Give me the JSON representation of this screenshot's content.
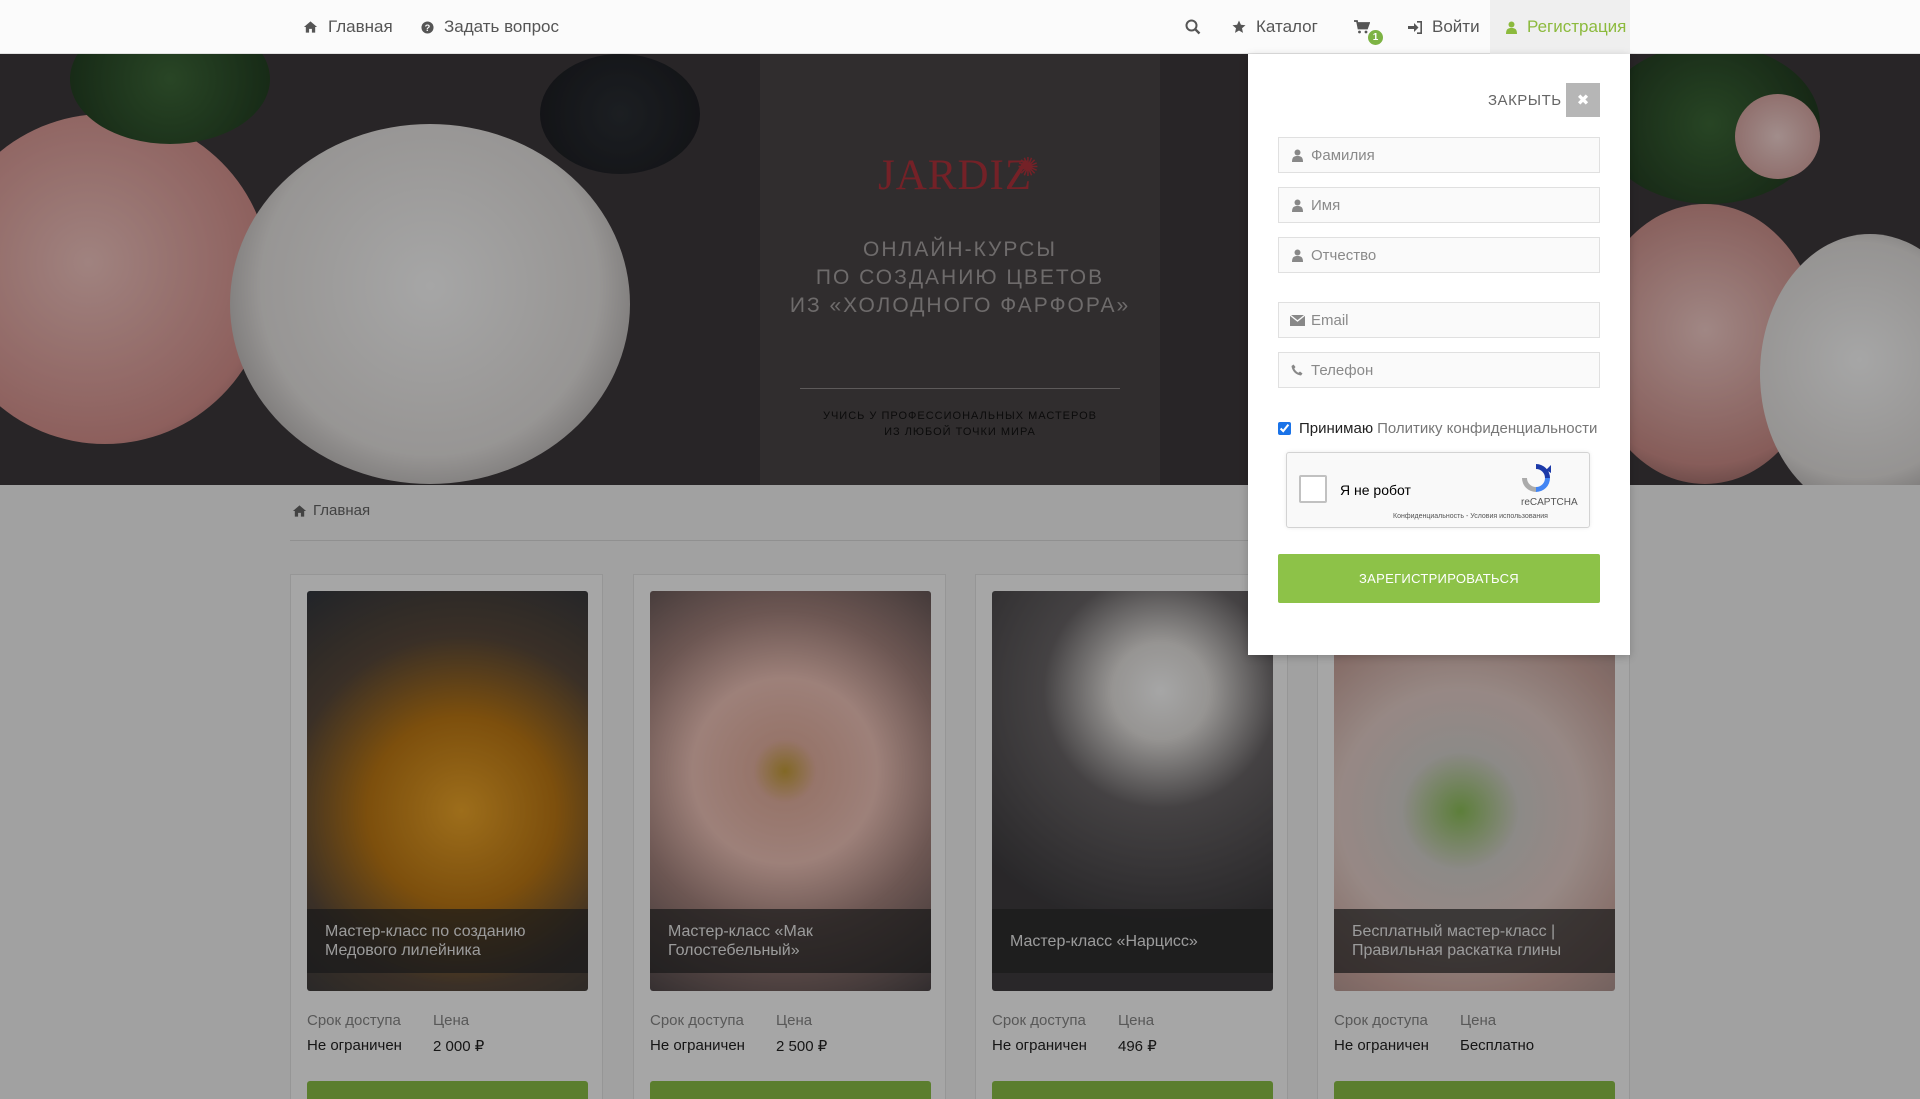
{
  "nav": {
    "home_label": "Главная",
    "ask_label": "Задать вопрос",
    "catalog_label": "Каталог",
    "cart_count": "1",
    "login_label": "Войти",
    "register_label": "Регистрация"
  },
  "hero": {
    "logo": "JARDIZ",
    "title": "ОНЛАЙН-КУРСЫ ПО СОЗДАНИЮ ЦВЕТОВ ИЗ «ХОЛОДНОГО ФАРФОРА»",
    "title_lines": [
      "ОНЛАЙН-КУРСЫ",
      "ПО СОЗДАНИЮ ЦВЕТОВ",
      "ИЗ «ХОЛОДНОГО ФАРФОРА»"
    ],
    "subtitle_lines": [
      "УЧИСЬ У ПРОФЕССИОНАЛЬНЫХ МАСТЕРОВ",
      "ИЗ ЛЮБОЙ ТОЧКИ МИРА"
    ]
  },
  "breadcrumb": {
    "home": "Главная"
  },
  "cards": [
    {
      "title": "Мастер-класс по созданию Медового лилейника",
      "access_label": "Срок доступа",
      "access_value": "Не ограничен",
      "price_label": "Цена",
      "price_value": "2 000 ₽"
    },
    {
      "title": "Мастер-класс «Мак Голостебельный»",
      "access_label": "Срок доступа",
      "access_value": "Не ограничен",
      "price_label": "Цена",
      "price_value": "2 500 ₽"
    },
    {
      "title": "Мастер-класс «Нарцисс»",
      "access_label": "Срок доступа",
      "access_value": "Не ограничен",
      "price_label": "Цена",
      "price_value": "496 ₽"
    },
    {
      "title": "Бесплатный мастер-класс | Правильная раскатка глины",
      "access_label": "Срок доступа",
      "access_value": "Не ограничен",
      "price_label": "Цена",
      "price_value": "Бесплатно"
    }
  ],
  "modal": {
    "close_label": "ЗАКРЫТЬ",
    "fields": {
      "lastname": {
        "placeholder": "Фамилия",
        "value": ""
      },
      "firstname": {
        "placeholder": "Имя",
        "value": ""
      },
      "middlename": {
        "placeholder": "Отчество",
        "value": ""
      },
      "email": {
        "placeholder": "Email",
        "value": ""
      },
      "phone": {
        "placeholder": "Телефон",
        "value": ""
      }
    },
    "consent_label": "Принимаю",
    "policy_link": "Политику конфиденциальности",
    "consent_checked": true,
    "recaptcha": {
      "label": "Я не робот",
      "brand": "reCAPTCHA",
      "terms": "Конфиденциальность - Условия использования"
    },
    "submit_label": "ЗАРЕГИСТРИРОВАТЬСЯ"
  },
  "colors": {
    "accent": "#8dc248",
    "active_nav": "#8cba3d",
    "logo": "#b2343d"
  }
}
